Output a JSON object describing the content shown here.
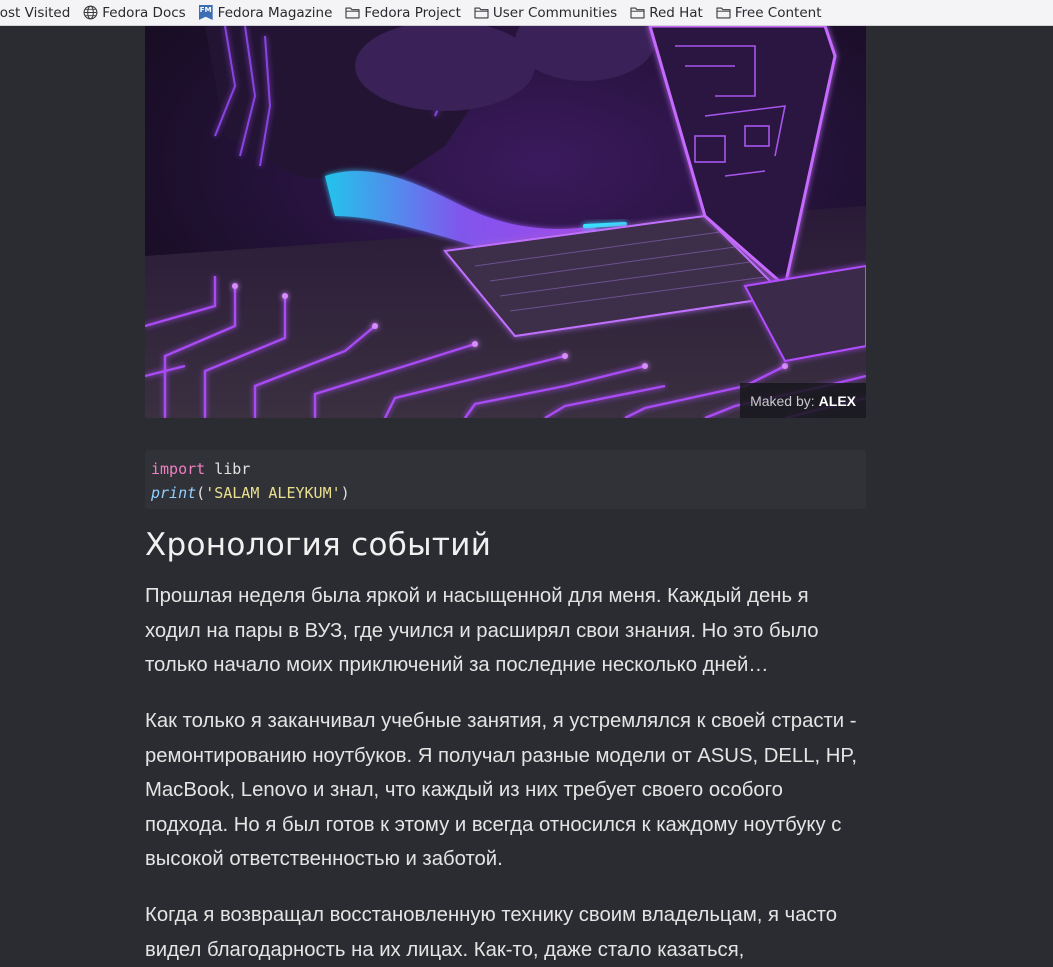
{
  "bookmarks": [
    {
      "label": "lost Visited",
      "icon": "none"
    },
    {
      "label": "Fedora Docs",
      "icon": "globe-icon"
    },
    {
      "label": "Fedora Magazine",
      "icon": "fedora-magazine-icon"
    },
    {
      "label": "Fedora Project",
      "icon": "folder-icon"
    },
    {
      "label": "User Communities",
      "icon": "folder-icon"
    },
    {
      "label": "Red Hat",
      "icon": "folder-icon"
    },
    {
      "label": "Free Content",
      "icon": "folder-icon"
    }
  ],
  "fedora_magazine_badge": "FM",
  "hero": {
    "caption_prefix": "Maked by:",
    "caption_author": "ALEX"
  },
  "code": {
    "line1_keyword": "import",
    "line1_rest": " libr",
    "line2_function": "print",
    "line2_open": "(",
    "line2_string": "'SALAM ALEYKUM'",
    "line2_close": ")"
  },
  "article": {
    "heading": "Хронология событий",
    "paragraphs": [
      "Прошлая неделя была яркой и насыщенной для меня. Каждый день я ходил на пары в ВУЗ, где учился и расширял свои знания. Но это было только начало моих приключений за последние несколько дней…",
      "Как только я заканчивал учебные занятия, я устремлялся к своей страсти - ремонтированию ноутбуков. Я получал разные модели от ASUS, DELL, HP, MacBook, Lenovo и знал, что каждый из них требует своего особого подхода. Но я был готов к этому и всегда относился к каждому ноутбуку с высокой ответственностью и заботой.",
      "Когда я возвращал восстановленную технику своим владельцам, я часто видел благодарность на их лицах. Как-то, даже стало казаться,"
    ]
  },
  "colors": {
    "page_bg": "#2b2c31",
    "neon_purple": "#a64dff",
    "neon_cyan": "#2ff0ff",
    "code_keyword": "#f07ec2",
    "code_string": "#e9e08e"
  }
}
